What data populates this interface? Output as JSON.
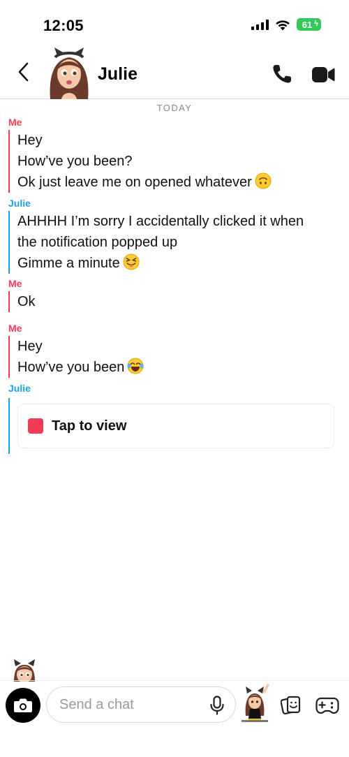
{
  "status_bar": {
    "time": "12:05",
    "battery": "61",
    "icons": [
      "signal-icon",
      "wifi-icon",
      "battery-charging-icon"
    ]
  },
  "header": {
    "contact_name": "Julie",
    "icons": [
      "back-chevron-icon",
      "phone-icon",
      "video-camera-icon"
    ]
  },
  "chat": {
    "day_label": "TODAY",
    "groups": [
      {
        "sender": "Me",
        "messages": [
          "Hey",
          "How’ve you been?",
          "Ok just leave me on opened whatever"
        ]
      },
      {
        "sender": "Julie",
        "messages": [
          "AHHHH I’m sorry I accidentally clicked it when the notification popped up",
          "Gimme a minute"
        ]
      },
      {
        "sender": "Me",
        "messages": [
          "Ok"
        ]
      },
      {
        "sender": "Me",
        "messages": [
          "Hey",
          "How’ve you been"
        ]
      },
      {
        "sender": "Julie",
        "snap_label": "Tap to view"
      }
    ]
  },
  "composer": {
    "placeholder": "Send a chat",
    "icons": [
      "camera-icon",
      "microphone-icon",
      "bitmoji-icon",
      "sticker-icon",
      "game-controller-icon"
    ]
  },
  "colors": {
    "me": "#f23c57",
    "julie": "#18a3e6",
    "battery": "#34c759"
  }
}
